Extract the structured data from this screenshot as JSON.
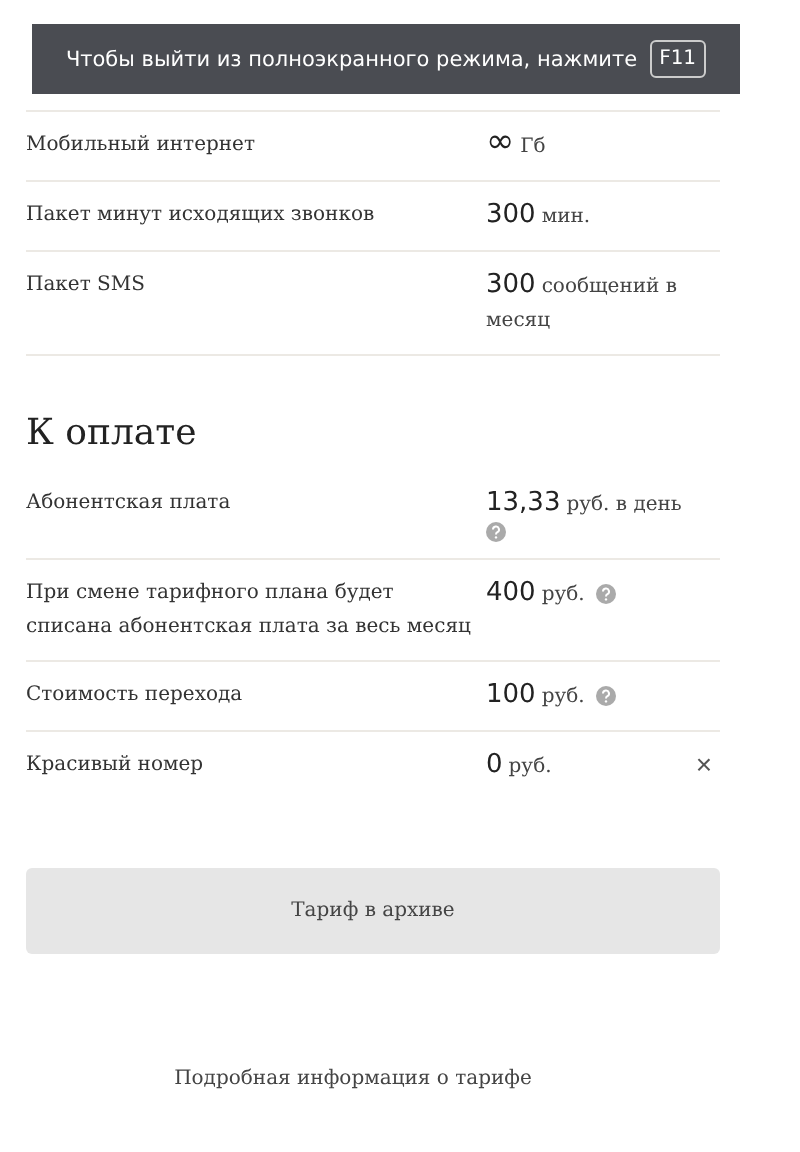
{
  "fullscreen_notice": {
    "text": "Чтобы выйти из полноэкранного режима, нажмите",
    "key": "F11"
  },
  "features": [
    {
      "label": "Мобильный интернет",
      "kind": "unlimited",
      "amount": "∞",
      "unit": "Гб"
    },
    {
      "label": "Пакет минут исходящих звонков",
      "kind": "amount",
      "amount": "300",
      "unit": "мин."
    },
    {
      "label": "Пакет SMS",
      "kind": "amount",
      "amount": "300",
      "unit": "сообщений в месяц"
    }
  ],
  "payment": {
    "title": "К оплате",
    "remove_glyph": "×",
    "rows": [
      {
        "label": "Абонентская плата",
        "amount": "13,33",
        "unit": "руб. в день",
        "help": true,
        "removable": false
      },
      {
        "label": "При смене тарифного плана будет списана абонентская плата за весь месяц",
        "amount": "400",
        "unit": "руб.",
        "help": true,
        "removable": false
      },
      {
        "label": "Стоимость перехода",
        "amount": "100",
        "unit": "руб.",
        "help": true,
        "removable": false
      },
      {
        "label": "Красивый номер",
        "amount": "0",
        "unit": "руб.",
        "help": false,
        "removable": true
      }
    ]
  },
  "archive_button": {
    "label": "Тариф в архиве",
    "disabled": true
  },
  "details_link": "Подробная информация о тарифе"
}
